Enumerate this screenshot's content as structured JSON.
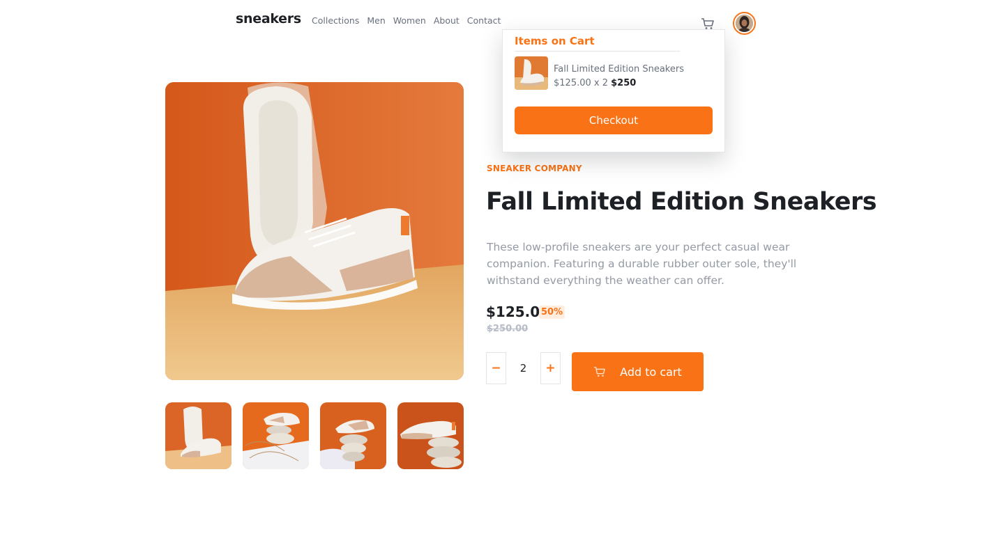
{
  "header": {
    "logo": "sneakers",
    "nav": [
      "Collections",
      "Men",
      "Women",
      "About",
      "Contact"
    ],
    "icons": {
      "cart": "cart-icon",
      "avatar": "avatar"
    }
  },
  "cart": {
    "title": "Items on Cart",
    "item_name": "Fall Limited Edition Sneakers",
    "item_unit": "$125.00 x 2",
    "item_total": "$250",
    "checkout_label": "Checkout"
  },
  "product": {
    "company": "SNEAKER COMPANY",
    "title": "Fall Limited Edition Sneakers",
    "description": "These low-profile sneakers are your perfect casual wear companion. Featuring a durable rubber outer sole, they'll withstand everything the weather can offer.",
    "price": "$125.00",
    "discount": "50%",
    "old_price": "$250.00",
    "quantity": "2",
    "minus_label": "−",
    "plus_label": "+",
    "add_to_cart_label": "Add to cart"
  },
  "colors": {
    "accent": "#f97316",
    "accent_pale": "#ffede0",
    "text_dark": "#1d2025",
    "text_muted": "#68707d",
    "text_light": "#949aa4"
  }
}
